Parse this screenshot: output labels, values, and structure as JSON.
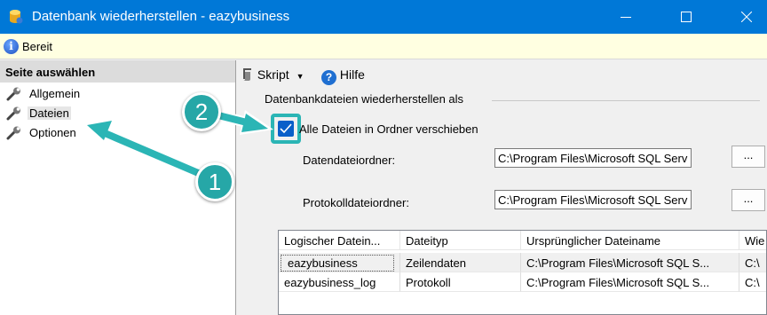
{
  "window": {
    "title": "Datenbank wiederherstellen - eazybusiness",
    "app_icon": "db-restore-icon",
    "controls": [
      "minimize-icon",
      "maximize-icon",
      "close-icon"
    ],
    "title_bar_color": "#0078d7"
  },
  "status": {
    "text": "Bereit",
    "icon": "info-icon"
  },
  "sidebar": {
    "header": "Seite auswählen",
    "items": [
      {
        "label": "Allgemein",
        "icon": "wrench-icon",
        "selected": false
      },
      {
        "label": "Dateien",
        "icon": "wrench-icon",
        "selected": true
      },
      {
        "label": "Optionen",
        "icon": "wrench-icon",
        "selected": false
      }
    ]
  },
  "toolbar": {
    "script_label": "Skript",
    "help_label": "Hilfe",
    "script_icon": "script-icon",
    "help_icon": "help-icon"
  },
  "main": {
    "section_title": "Datenbankdateien wiederherstellen als",
    "move_all_checkbox": {
      "label": "Alle Dateien in Ordner verschieben",
      "checked": true
    },
    "data_folder": {
      "label": "Datendateiordner:",
      "value": "C:\\Program Files\\Microsoft SQL Serv",
      "browse_label": "..."
    },
    "log_folder": {
      "label": "Protokolldateiordner:",
      "value": "C:\\Program Files\\Microsoft SQL Serv",
      "browse_label": "..."
    },
    "grid": {
      "columns": [
        "Logischer Datein...",
        "Dateityp",
        "Ursprünglicher Dateiname",
        "Wie"
      ],
      "rows": [
        [
          "eazybusiness",
          "Zeilendaten",
          "C:\\Program Files\\Microsoft SQL S...",
          "C:\\"
        ],
        [
          "eazybusiness_log",
          "Protokoll",
          "C:\\Program Files\\Microsoft SQL S...",
          "C:\\"
        ]
      ]
    }
  },
  "callouts": [
    {
      "number": "1",
      "color": "#26a7a7"
    },
    {
      "number": "2",
      "color": "#26a7a7"
    }
  ]
}
